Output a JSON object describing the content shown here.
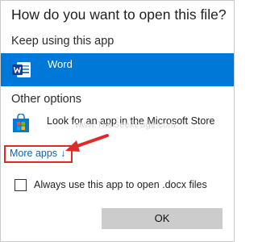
{
  "dialog": {
    "title": "How do you want to open this file?",
    "keep_label": "Keep using this app",
    "selected_app": {
      "name": "Word",
      "icon": "word-icon",
      "color": "#0078d7"
    },
    "other_label": "Other options",
    "store_option": {
      "label": "Look for an app in the Microsoft Store",
      "icon": "store-icon"
    },
    "more_apps": {
      "label": "More apps",
      "icon_glyph": "↓"
    },
    "checkbox": {
      "label": "Always use this app to open .docx files",
      "checked": false
    },
    "ok_label": "OK"
  },
  "watermark": {
    "text": "www.TheGeekPage.com"
  },
  "colors": {
    "accent": "#0078d7",
    "highlight": "#e02a2a",
    "link": "#0067c0"
  }
}
